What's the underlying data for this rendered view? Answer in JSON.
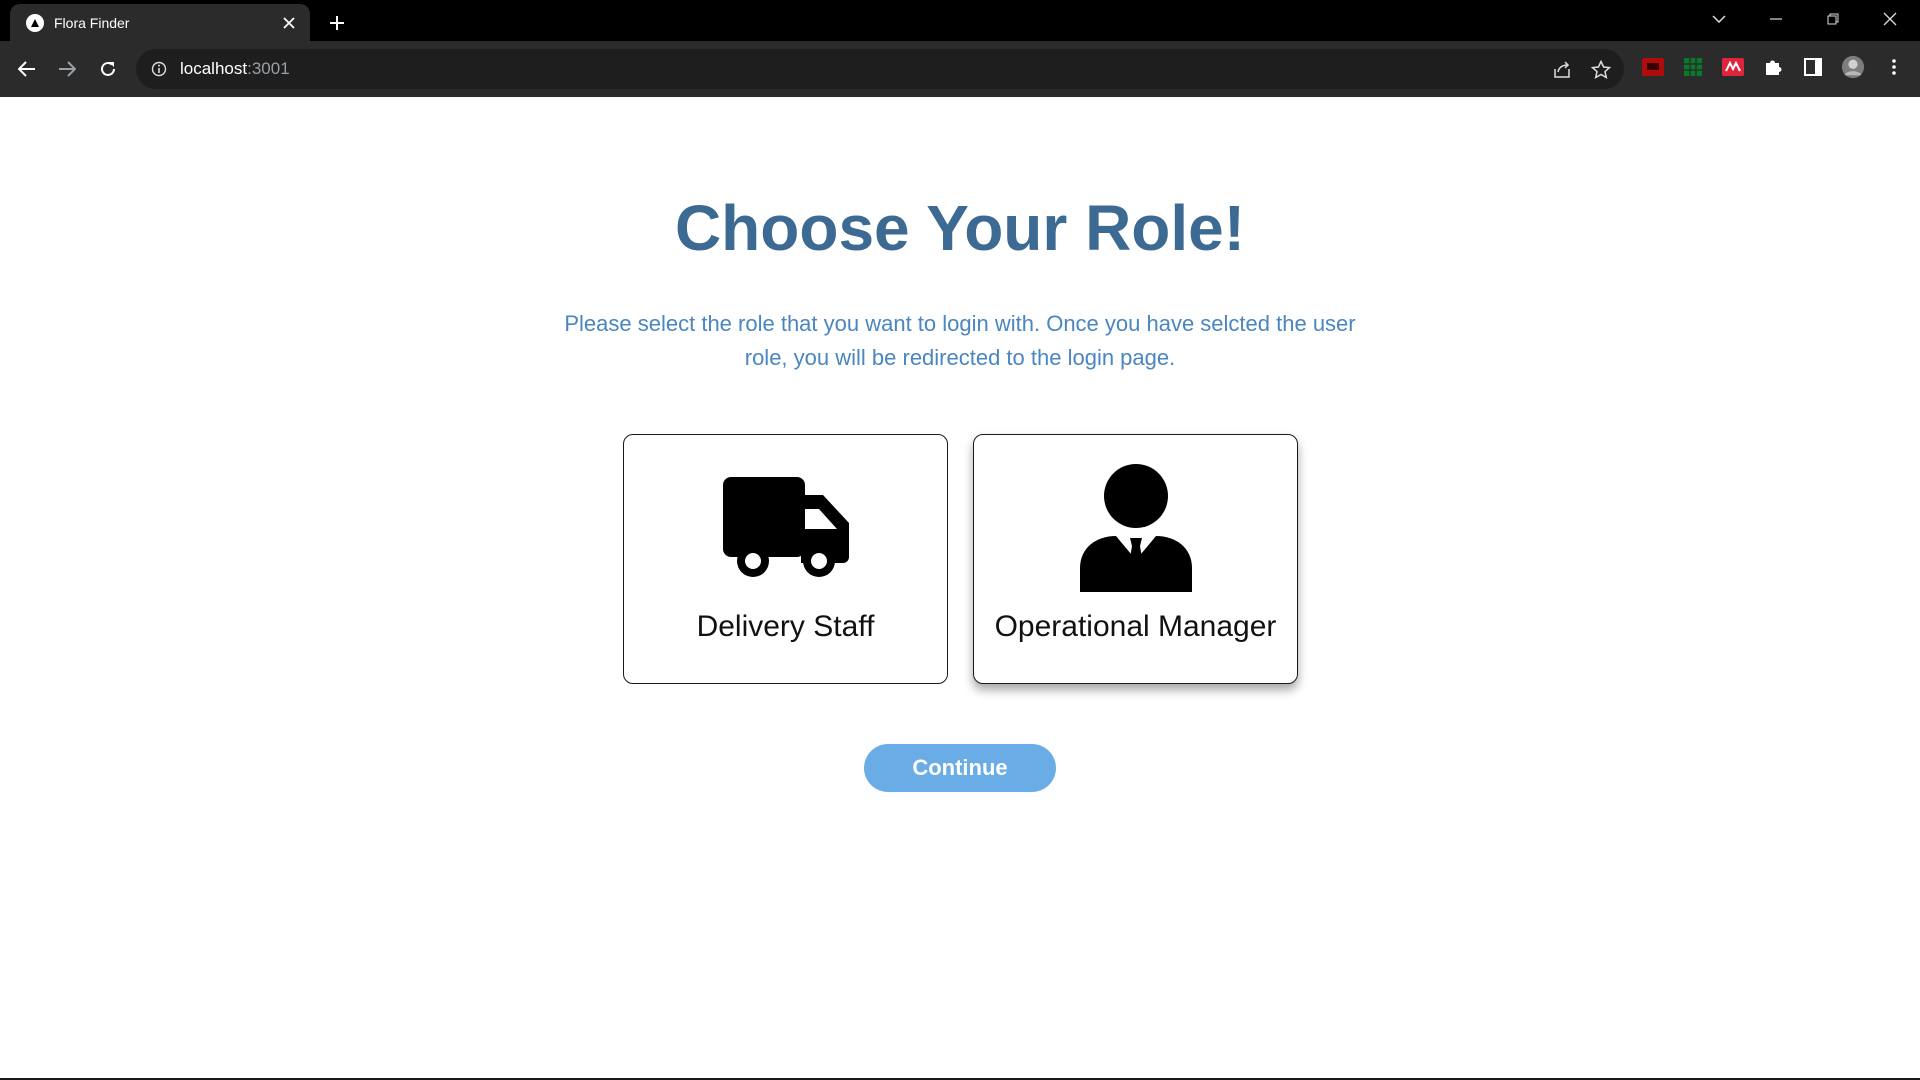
{
  "browser": {
    "tab_title": "Flora Finder",
    "url_host": "localhost",
    "url_port": ":3001"
  },
  "page": {
    "heading": "Choose Your Role!",
    "subtitle": "Please select the role that you want to login with. Once you have selcted the user role, you will be redirected to the login page.",
    "roles": [
      {
        "label": "Delivery Staff",
        "icon": "truck-icon",
        "selected": false
      },
      {
        "label": "Operational Manager",
        "icon": "businessman-icon",
        "selected": true
      }
    ],
    "continue_label": "Continue"
  },
  "colors": {
    "heading": "#3d6a93",
    "subtitle": "#4a86bf",
    "button": "#6aace6"
  }
}
